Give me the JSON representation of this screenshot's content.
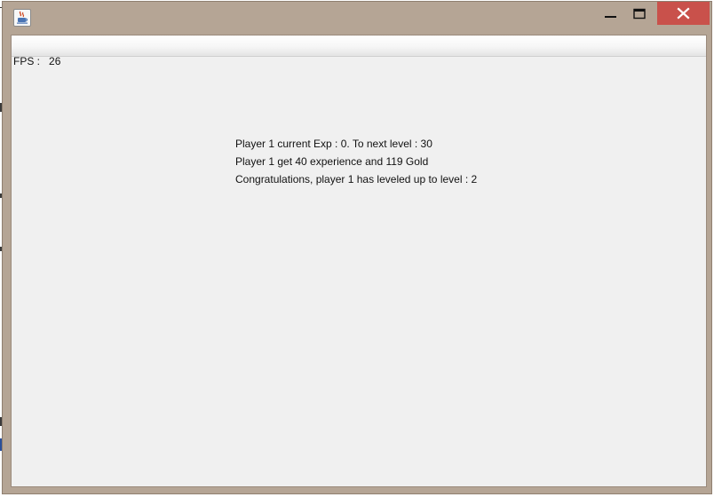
{
  "window": {
    "app_icon": "java-cup-icon",
    "buttons": {
      "minimize_icon": "minimize-icon",
      "maximize_icon": "maximize-icon",
      "close_icon": "close-icon"
    },
    "colors": {
      "frame": "#b5a595",
      "close_button": "#c9514b",
      "client_background": "#f0f0f0"
    }
  },
  "game": {
    "fps_label": "FPS :",
    "fps_value": "26",
    "log": [
      "Player 1 current Exp : 0. To next level : 30",
      "Player 1 get 40 experience and 119 Gold",
      "Congratulations, player 1 has leveled up to level : 2"
    ]
  }
}
